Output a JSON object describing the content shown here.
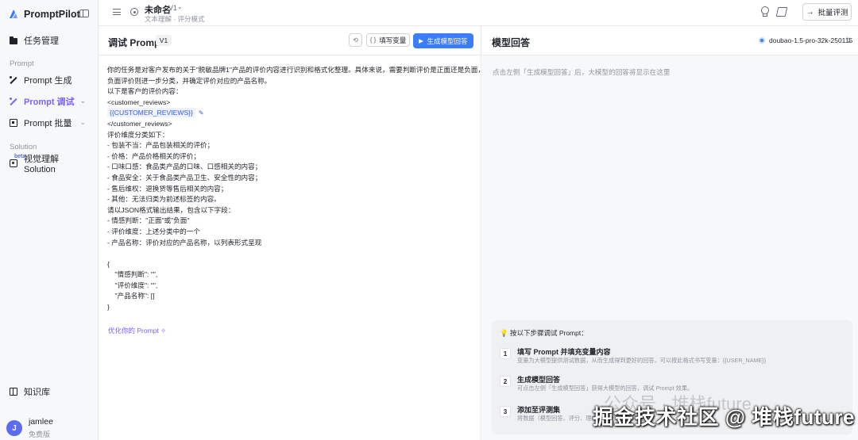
{
  "sidebar": {
    "brand": "PromptPilot",
    "items": {
      "task_mgmt": "任务管理",
      "prompt_section": "Prompt",
      "prompt_gen": "Prompt 生成",
      "prompt_debug": "Prompt 调试",
      "prompt_batch": "Prompt 批量",
      "solution_section": "Solution",
      "beta": "beta",
      "visual_solution": "视觉理解 Solution",
      "knowledge": "知识库"
    },
    "user": {
      "name": "jamlee",
      "plan": "免费版",
      "initial": "J"
    }
  },
  "topbar": {
    "title": "未命名",
    "version": "V1",
    "subtitle": "文本理解 · 评分模式",
    "batch_eval": "批量评测"
  },
  "editor": {
    "title": "调试 Prompt",
    "version_tag": "V1",
    "fill_vars": "填写变量",
    "generate": "生成模型回答",
    "lines": {
      "l1": "你的任务是对客户发布的关于\"脱敏品牌1\"产品的评价内容进行识别和格式化整理。具体来说，需要判断评价是正面还是负面，若为",
      "l2": "负面评价则进一步分类，并确定评价对应的产品名称。",
      "l3": "以下是客户的评价内容：",
      "l4": "<customer_reviews>",
      "l5_var": "{{CUSTOMER_REVIEWS}}",
      "l6": "</customer_reviews>",
      "l7": "评价维度分类如下：",
      "l8": "- 包装不当：产品包装相关的评价；",
      "l9": "- 价格：产品价格相关的评价；",
      "l10": "- 口味口感：食品类产品的口味、口感相关的内容；",
      "l11": "- 食品安全：关于食品类产品卫生、安全性的内容；",
      "l12": "- 售后维权：退换货等售后相关的内容；",
      "l13": "- 其他：无法归类为前述标签的内容。",
      "l14": "请以JSON格式输出结果，包含以下字段：",
      "l15": "- 情感判断：\"正面\"或\"负面\"",
      "l16": "- 评价维度：上述分类中的一个",
      "l17": "- 产品名称：评价对应的产品名称，以列表形式呈现",
      "l18": "{",
      "l19": "    \"情感判断\": \"\",",
      "l20": "    \"评价维度\": \"\",",
      "l21": "    \"产品名称\": []",
      "l22": "}"
    },
    "optimize": "优化你的 Prompt"
  },
  "response": {
    "title": "模型回答",
    "model": "doubao-1.5-pro-32k-250115",
    "hint": "点击左侧「生成模型回答」后，大模型的回答将显示在这里",
    "steps_heading": "按以下步骤调试 Prompt：",
    "steps": [
      {
        "num": "1",
        "title": "填写 Prompt 并填充变量内容",
        "desc": "变量为大模型提供测试数据，从而生成得到更好的回答，可以按此格式书写变量：{{USER_NAME}}"
      },
      {
        "num": "2",
        "title": "生成模型回答",
        "desc": "可点击左侧「生成模型回答」获得大模型的回答，调试 Prompt 效果。"
      },
      {
        "num": "3",
        "title": "添加至评测集",
        "desc": "将数据（模型回答、评分、理想回答）添加至评测集"
      }
    ]
  },
  "watermark": {
    "faint": "公众号 · 堆栈future",
    "main": "掘金技术社区 @ 堆栈future"
  }
}
